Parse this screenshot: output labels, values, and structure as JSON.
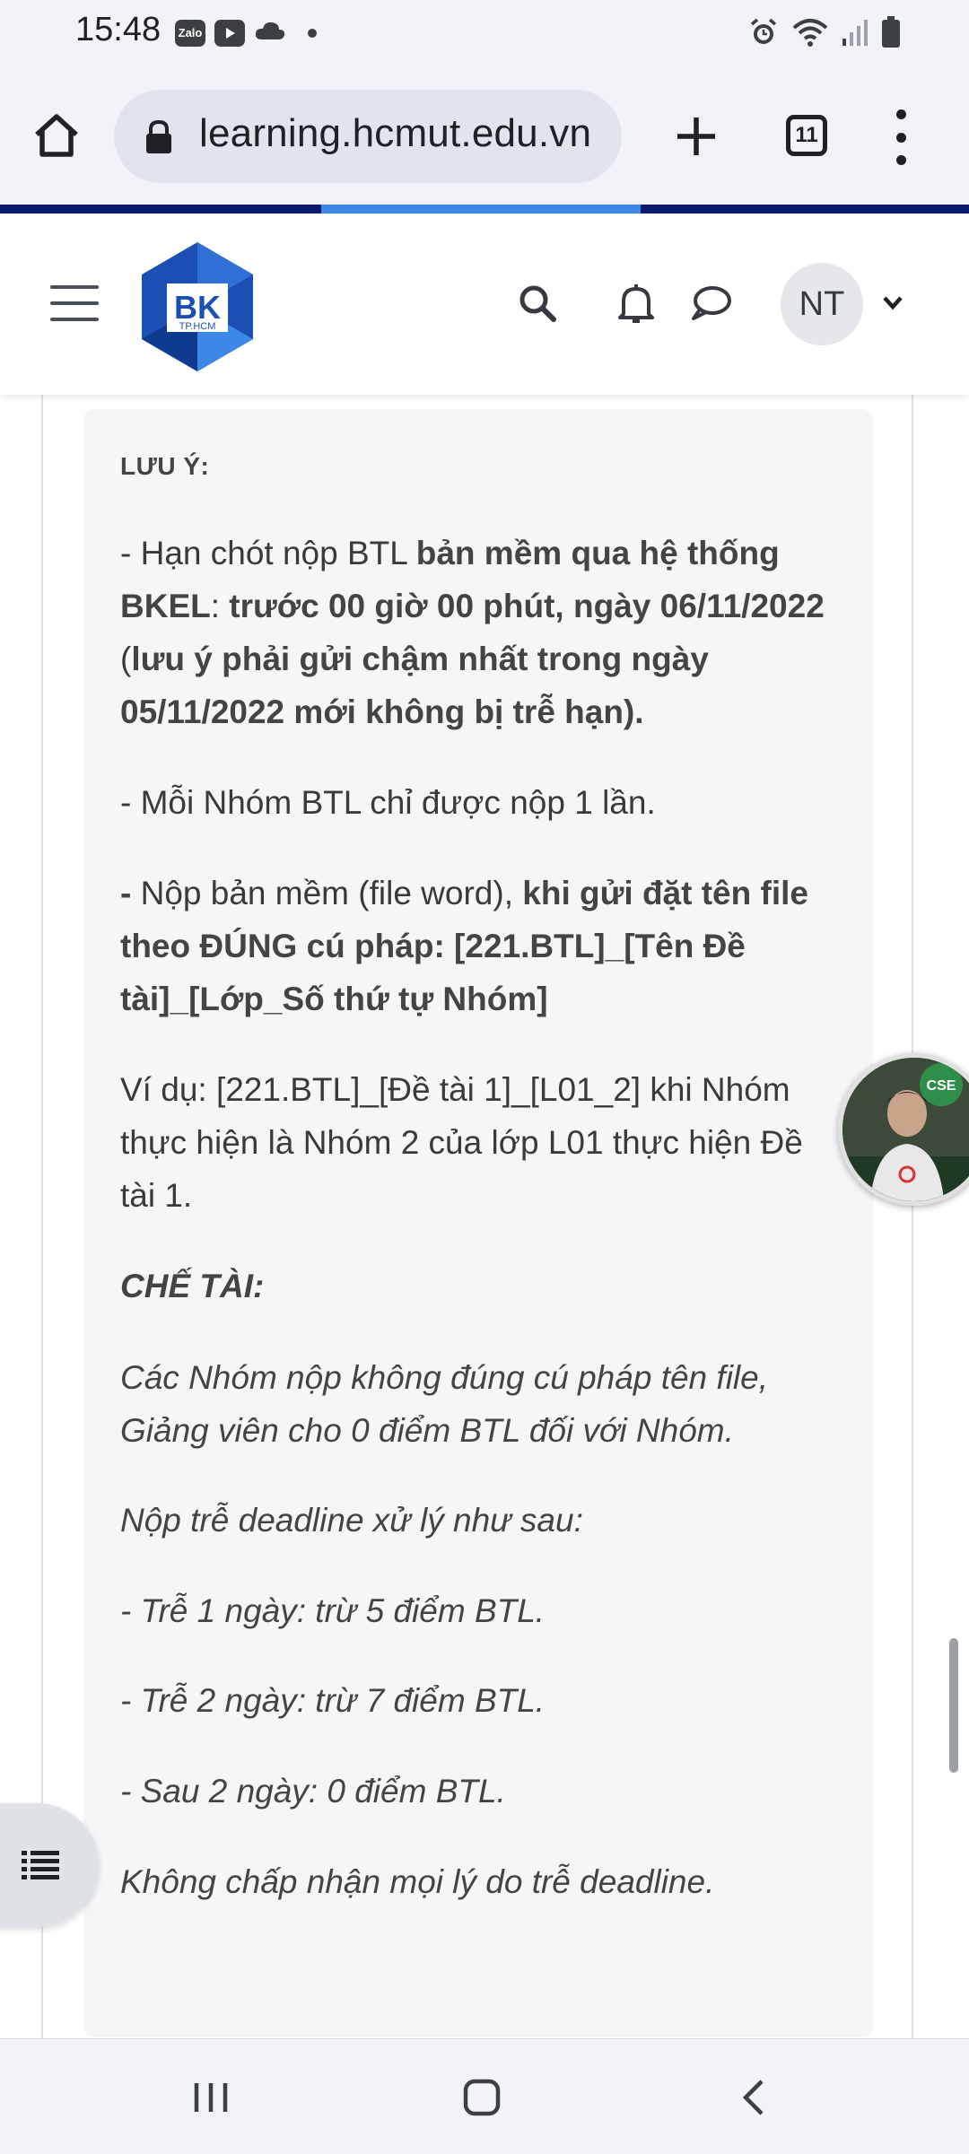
{
  "status_bar": {
    "time": "15:48",
    "apps": [
      "Zalo",
      "youtube-icon",
      "cloud-icon"
    ],
    "right_icons": [
      "alarm-icon",
      "wifi-icon",
      "signal-icon",
      "battery-icon"
    ]
  },
  "browser": {
    "url": "learning.hcmut.edu.vn",
    "tab_count": "11"
  },
  "site_header": {
    "logo_text": "BK",
    "logo_subtext": "TP.HCM",
    "user_initials": "NT",
    "icons": [
      "search-icon",
      "bell-icon",
      "chat-icon"
    ]
  },
  "content": {
    "note_title": "LƯU Ý:",
    "p1_a": "- Hạn chót nộp BTL ",
    "p1_b": "bản mềm qua hệ thống BKEL",
    "p1_c": ": ",
    "p1_d": "trước 00 giờ 00 phút, ngày 06/11/2022",
    "p1_e": " (",
    "p1_f": "lưu ý phải gửi chậm nhất trong ngày 05/11/2022 mới không bị trễ hạn).",
    "p2": "- Mỗi Nhóm BTL chỉ được nộp 1 lần.",
    "p3_a": "-",
    "p3_b": " Nộp bản mềm (file word), ",
    "p3_c": "khi gửi đặt tên file theo ĐÚNG cú pháp: [221.BTL]_[Tên Đề tài]_[Lớp_Số thứ tự Nhóm]",
    "p4": "Ví dụ: [221.BTL]_[Đề tài 1]_[L01_2] khi Nhóm thực hiện là Nhóm 2 của lớp L01 thực hiện Đề tài 1.",
    "sanction_title": "CHẾ TÀI:",
    "s1": "Các Nhóm nộp không đúng cú pháp tên file, Giảng viên cho 0 điểm BTL đối với Nhóm.",
    "s2": "Nộp trễ deadline xử lý như sau:",
    "s3": "- Trễ 1 ngày: trừ 5 điểm BTL.",
    "s4": "- Trễ 2 ngày: trừ 7 điểm BTL.",
    "s5": "- Sau 2 ngày: 0 điểm BTL.",
    "s6": "Không chấp nhận mọi lý do trễ deadline."
  },
  "colors": {
    "brand_dark": "#0a1a6e",
    "brand_light": "#3c87e8",
    "logo_blue": "#1b4fb3"
  }
}
